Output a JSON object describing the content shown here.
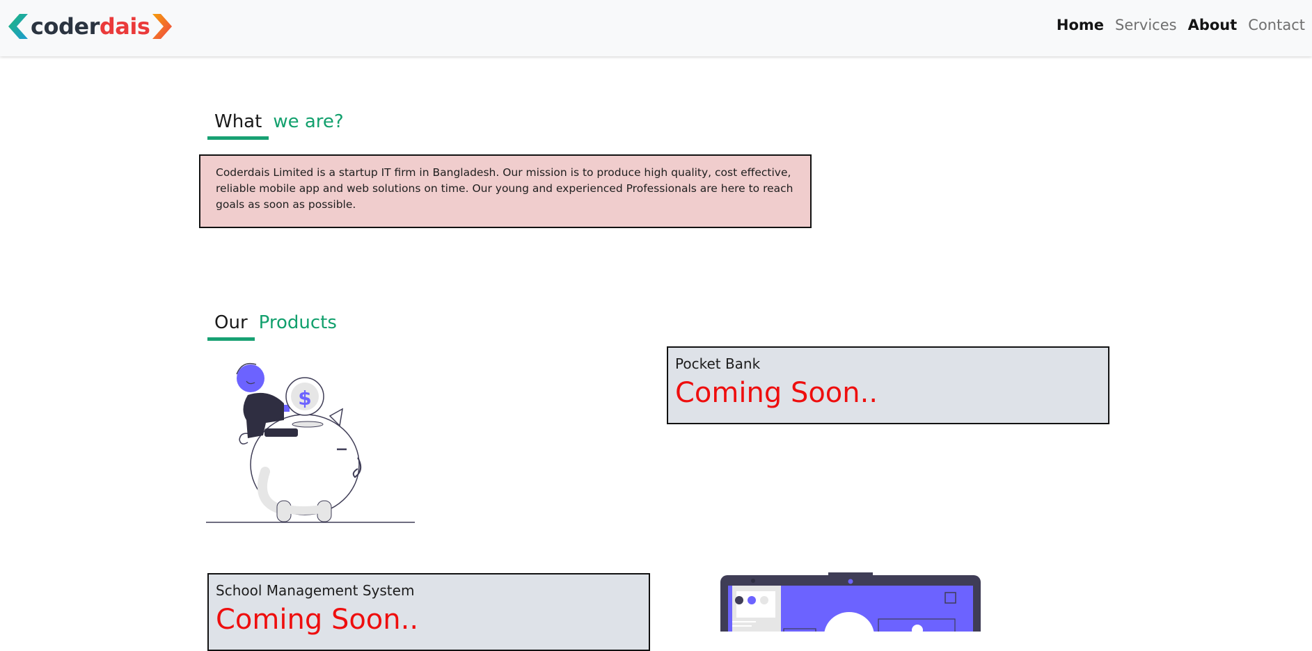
{
  "brand": {
    "part1": "coder",
    "part2": "dais"
  },
  "nav": {
    "items": [
      {
        "label": "Home",
        "active": true
      },
      {
        "label": "Services",
        "active": false
      },
      {
        "label": "About",
        "active": true
      },
      {
        "label": "Contact",
        "active": false
      }
    ]
  },
  "about": {
    "title_word1": "What",
    "title_word2": "we are?",
    "text": "Coderdais Limited is a startup IT firm in Bangladesh. Our mission is to produce high quality, cost effective, reliable mobile app and web solutions on time. Our young and experienced Professionals are here to reach goals as soon as possible."
  },
  "products": {
    "title_word1": "Our",
    "title_word2": "Products",
    "items": [
      {
        "name": "Pocket Bank",
        "status": "Coming Soon..",
        "illustration": "piggy-bank-illustration"
      },
      {
        "name": "School Management System",
        "status": "Coming Soon..",
        "illustration": "laptop-illustration"
      }
    ]
  },
  "colors": {
    "accent_green": "#18a173",
    "status_red": "#ee0e0e",
    "about_bg": "#f0cdcd",
    "card_bg": "#dee2e8",
    "illustration_purple": "#6c63ff"
  }
}
